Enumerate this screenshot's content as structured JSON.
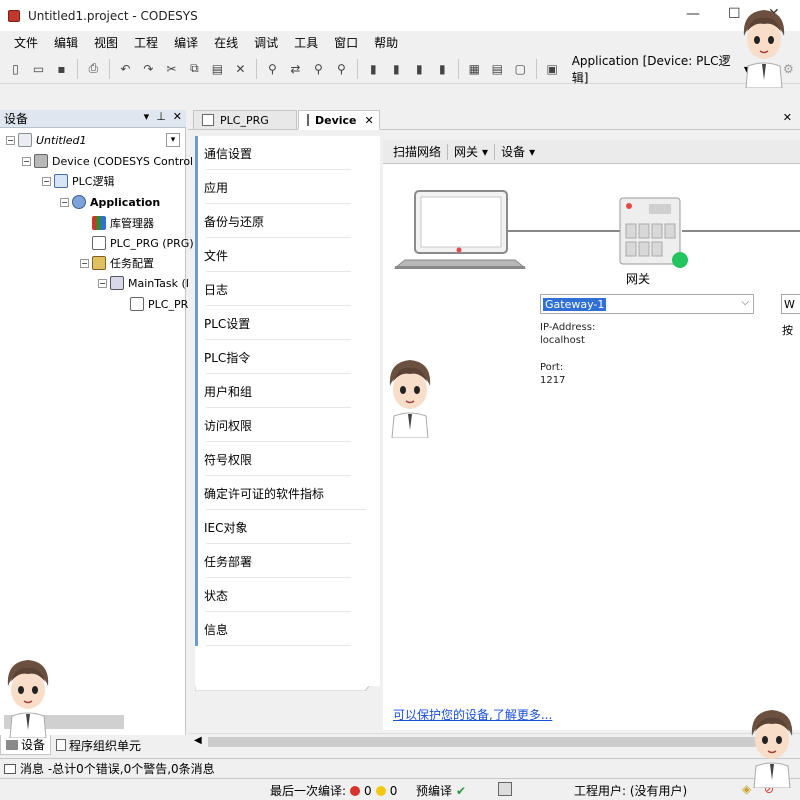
{
  "window": {
    "title": "Untitled1.project - CODESYS",
    "minimize": "—",
    "maximize": "☐",
    "close": "✕"
  },
  "menu": [
    "文件",
    "编辑",
    "视图",
    "工程",
    "编译",
    "在线",
    "调试",
    "工具",
    "窗口",
    "帮助"
  ],
  "toolbar": {
    "application_selector": "Application [Device: PLC逻辑]"
  },
  "devices_panel": {
    "title": "设备",
    "tree": [
      {
        "label": "Untitled1",
        "level": 0,
        "icon": "project-icon",
        "italic": true
      },
      {
        "label": "Device (CODESYS Control W",
        "level": 1,
        "icon": "device-icon"
      },
      {
        "label": "PLC逻辑",
        "level": 2,
        "icon": "plc-logic-icon"
      },
      {
        "label": "Application",
        "level": 3,
        "icon": "application-gear-icon",
        "bold": true
      },
      {
        "label": "库管理器",
        "level": 4,
        "icon": "library-books-icon"
      },
      {
        "label": "PLC_PRG (PRG)",
        "level": 4,
        "icon": "program-icon"
      },
      {
        "label": "任务配置",
        "level": 4,
        "icon": "task-config-icon"
      },
      {
        "label": "MainTask (I",
        "level": 5,
        "icon": "maintask-icon"
      },
      {
        "label": "PLC_PR",
        "level": 6,
        "icon": "program-call-icon"
      }
    ],
    "tabs": [
      {
        "label": "设备",
        "active": true
      },
      {
        "label": "程序组织单元",
        "active": false
      }
    ]
  },
  "editor_tabs": [
    {
      "label": "PLC_PRG",
      "active": false
    },
    {
      "label": "Device",
      "active": true
    }
  ],
  "device_pages": [
    "通信设置",
    "应用",
    "备份与还原",
    "文件",
    "日志",
    "PLC设置",
    "PLC指令",
    "用户和组",
    "访问权限",
    "符号权限",
    "确定许可证的软件指标",
    "IEC对象",
    "任务部署",
    "状态",
    "信息"
  ],
  "content": {
    "toolbar": [
      "扫描网络",
      "网关",
      "设备"
    ],
    "gateway_label": "网关",
    "gateway_selected": "Gateway-1",
    "ip_label": "IP-Address:",
    "ip_value": "localhost",
    "port_label": "Port:",
    "port_value": "1217",
    "right_field": "W",
    "right_hint": "按",
    "learn_more": "可以保护您的设备,了解更多...",
    "status_color": "#22c55e"
  },
  "message_bar": "消息 -总计0个错误,0个警告,0条消息",
  "status": {
    "last_compile": "最后一次编译:",
    "errors": "0",
    "warnings": "0",
    "precompile": "预编译",
    "project_user": "工程用户: (没有用户)"
  },
  "colors": {
    "accent": "#6b9bd1",
    "link": "#1a4fd8",
    "selection": "#2f6fd6"
  }
}
